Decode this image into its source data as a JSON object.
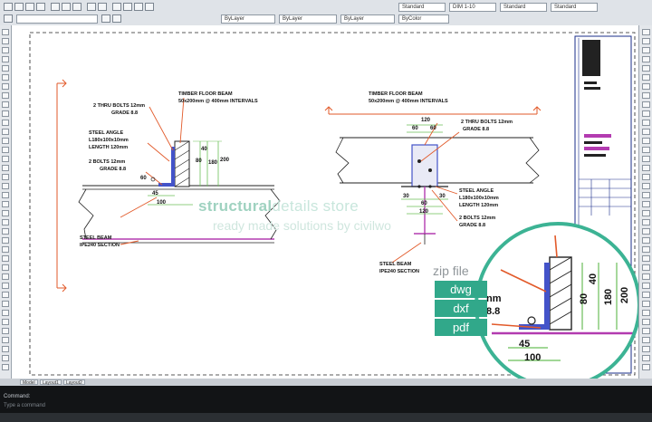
{
  "toolbar": {
    "layer_combo": "ByLayer",
    "linetype_combo": "ByLayer",
    "lineweight_combo": "ByLayer",
    "color_combo": "ByColor",
    "text_style": "Standard",
    "dim_style": "DIM 1-10",
    "table_style": "Standard",
    "multileader_style": "Standard"
  },
  "command": {
    "prompt_label": "Command:",
    "placeholder": "Type a command"
  },
  "tabs": [
    "Model",
    "Layout1",
    "Layout2"
  ],
  "watermark": {
    "brand_bold": "structural",
    "brand_rest": "details store",
    "tagline": "ready made solutions by civilwo"
  },
  "downloads": {
    "title": "zip file",
    "formats": [
      "dwg",
      "dxf",
      "pdf"
    ]
  },
  "left_detail": {
    "timber_beam": "TIMBER FLOOR BEAM",
    "timber_size": "50x200mm @ 400mm INTERVALS",
    "thru_bolts": "2 THRU BOLTS 12mm",
    "thru_grade": "GRADE 8.8",
    "angle": "STEEL ANGLE",
    "angle_size": "L180x100x10mm",
    "angle_length": "LENGTH 120mm",
    "bolts": "2 BOLTS 12mm",
    "bolts_grade": "GRADE 8.8",
    "steel_beam": "STEEL BEAM",
    "steel_section": "IPE240 SECTION",
    "dims": [
      "40",
      "80",
      "180",
      "200",
      "45",
      "100",
      "60"
    ]
  },
  "right_detail": {
    "timber_beam": "TIMBER FLOOR BEAM",
    "timber_size": "50x200mm @ 400mm INTERVALS",
    "thru_bolts": "2 THRU BOLTS 12mm",
    "thru_grade": "GRADE 8.8",
    "angle": "STEEL ANGLE",
    "angle_size": "L180x100x10mm",
    "angle_length": "LENGTH 120mm",
    "bolts": "2 BOLTS 12mm",
    "bolts_grade": "GRADE 8.8",
    "steel_beam": "STEEL BEAM",
    "steel_section": "IPE240 SECTION",
    "dims": [
      "120",
      "60",
      "60",
      "30",
      "30",
      "60",
      "120"
    ]
  },
  "zoom_detail": {
    "dims": [
      "40",
      "80",
      "180",
      "200",
      "45",
      "100"
    ],
    "partial_labels": [
      "nm",
      "8.8"
    ]
  }
}
